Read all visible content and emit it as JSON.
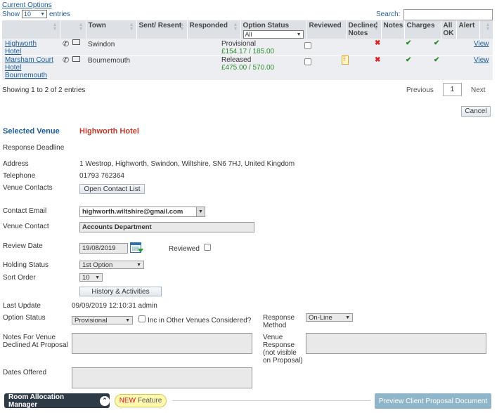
{
  "header": {
    "current_options_link": "Current Options",
    "show_label": "Show",
    "entries_value": "10",
    "entries_label": "entries",
    "search_label": "Search:",
    "search_value": ""
  },
  "table": {
    "columns": [
      "Town",
      "Sent/ Resent",
      "Responded",
      "Option Status",
      "Reviewed",
      "Declined Notes",
      "Notes",
      "Charges",
      "All OK",
      "Alert"
    ],
    "option_status_filter": "All",
    "rows": [
      {
        "venue": "Highworth Hotel",
        "town": "Swindon",
        "status": "Provisional",
        "amount": "£154.17 / 185.00",
        "view": "View"
      },
      {
        "venue": "Marsham Court Hotel Bournemouth",
        "town": "Bournemouth",
        "status": "Released",
        "amount": "£475.00 / 570.00",
        "view": "View"
      }
    ]
  },
  "pager": {
    "info": "Showing 1 to 2 of 2 entries",
    "previous": "Previous",
    "page": "1",
    "next": "Next"
  },
  "cancel_label": "Cancel",
  "detail": {
    "selected_venue_label": "Selected Venue",
    "selected_venue_name": "Highworth Hotel",
    "response_deadline_label": "Response Deadline",
    "address_label": "Address",
    "address_value": "1 Westrop, Highworth, Swindon, Wiltshire, SN6 7HJ, United Kingdom",
    "telephone_label": "Telephone",
    "telephone_value": "01793 762364",
    "venue_contacts_label": "Venue Contacts",
    "open_contact_list": "Open Contact List",
    "contact_email_label": "Contact Email",
    "contact_email_value": "highworth.wiltshire@gmail.com",
    "venue_contact_label": "Venue Contact",
    "venue_contact_value": "Accounts Department",
    "review_date_label": "Review Date",
    "review_date_value": "19/08/2019",
    "reviewed_label": "Reviewed",
    "holding_status_label": "Holding Status",
    "holding_status_value": "1st Option",
    "sort_order_label": "Sort Order",
    "sort_order_value": "10",
    "history_button": "History & Activities",
    "last_update_label": "Last Update",
    "last_update_value": "09/09/2019 12:10:31 admin",
    "option_status_label": "Option Status",
    "option_status_value": "Provisional",
    "inc_other_label": "Inc in Other Venues Considered?",
    "response_method_label": "Response Method",
    "response_method_value": "On-Line",
    "notes_declined_label": "Notes For Venue Declined At Proposal",
    "venue_response_label": "Venue Response (not visible on Proposal)",
    "dates_offered_label": "Dates Offered"
  },
  "footer": {
    "room_allocation": "Room Allocation Manager",
    "new_word": "NEW",
    "feature_word": " Feature",
    "preview_button": "Preview Client Proposal Document"
  },
  "colors": {
    "accent_blue": "#1f5c99",
    "venue_red": "#c0392b",
    "price_green": "#2f8c2f",
    "footer_dark": "#2e3b47",
    "preview_button": "#8fb6c8"
  }
}
